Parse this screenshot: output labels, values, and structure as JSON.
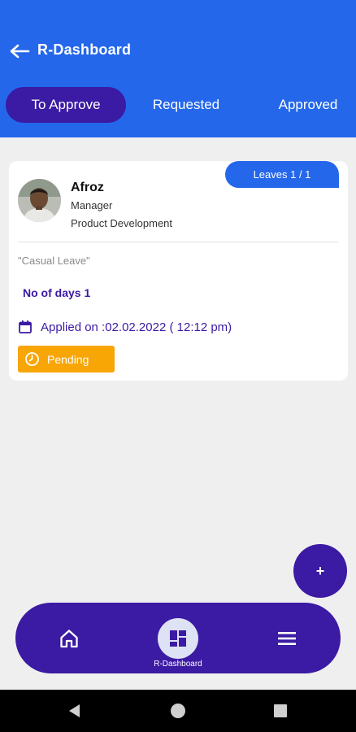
{
  "header": {
    "title": "R-Dashboard",
    "back_icon": "arrow-left-icon",
    "background_color": "#2467ea"
  },
  "tabs": [
    {
      "label": "To Approve",
      "active": true
    },
    {
      "label": "Requested",
      "active": false
    },
    {
      "label": "Approved",
      "active": false
    }
  ],
  "card": {
    "badge": "Leaves 1 / 1",
    "employee": {
      "name": "Afroz",
      "role": "Manager",
      "department": "Product Development",
      "avatar_icon": "profile-photo"
    },
    "leave_type": "\"Casual Leave\"",
    "days": "No of days 1",
    "applied_on": "Applied on :02.02.2022 ( 12:12 pm)",
    "status": "Pending",
    "status_color": "#f8a506"
  },
  "fab": {
    "label": "+"
  },
  "bottom_nav": {
    "items": [
      {
        "icon": "home-icon"
      },
      {
        "icon": "dashboard-icon",
        "label": "R-Dashboard",
        "active": true
      },
      {
        "icon": "menu-icon"
      }
    ],
    "background_color": "#3b1aa4"
  },
  "system_bar": {
    "icons": [
      "back-triangle-icon",
      "home-circle-icon",
      "recents-square-icon"
    ]
  }
}
